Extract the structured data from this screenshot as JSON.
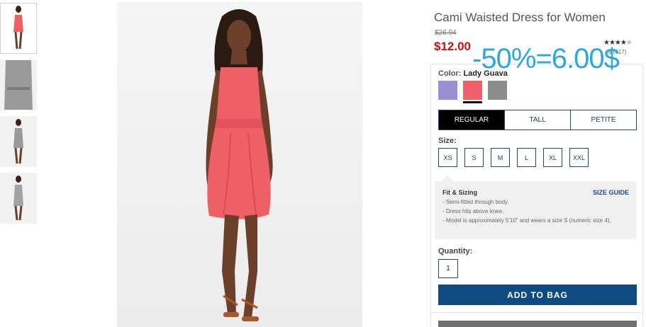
{
  "thumbnails": [
    {
      "name": "thumb-front",
      "active": true
    },
    {
      "name": "thumb-gray-detail",
      "active": false
    },
    {
      "name": "thumb-gray-front",
      "active": false
    },
    {
      "name": "thumb-gray-back",
      "active": false
    }
  ],
  "product": {
    "title": "Cami Waisted Dress for Women",
    "old_price": "$26.94",
    "price": "$12.00",
    "rating_stars": "★★★★",
    "rating_empty": "★",
    "reviews": "8 (417)",
    "discount_overlay": "-50%=6.00$"
  },
  "color": {
    "label": "Color:",
    "selected_name": "Lady Guava",
    "swatches": [
      "#9b8fd4",
      "#f0606b",
      "#8c8c8c"
    ],
    "selected_index": 1
  },
  "fit": {
    "tabs": [
      "REGULAR",
      "TALL",
      "PETITE"
    ],
    "selected_index": 0
  },
  "size": {
    "label": "Size:",
    "options": [
      "XS",
      "S",
      "M",
      "L",
      "XL",
      "XXL"
    ]
  },
  "fit_sizing": {
    "title": "Fit & Sizing",
    "guide_link": "SIZE GUIDE",
    "items": [
      "- Semi-fitted through body.",
      "- Dress hits above knee.",
      "- Model is approximately 5'10\" and wears a size S (numeric size 4)."
    ]
  },
  "quantity": {
    "label": "Quantity:",
    "value": "1"
  },
  "add_to_bag": "ADD TO BAG",
  "colors": {
    "price_red": "#d10d0d",
    "accent_blue": "#0f4a80",
    "overlay_blue": "#2ea8d8",
    "dress": "#ef5f66"
  }
}
